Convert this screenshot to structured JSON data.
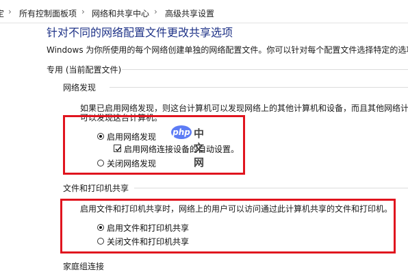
{
  "breadcrumb": {
    "items": [
      "所有控制面板项",
      "网络和共享中心",
      "高级共享设置"
    ],
    "partial_first": "定"
  },
  "main": {
    "heading": "针对不同的网络配置文件更改共享选项",
    "description": "Windows 为你所使用的每个网络创建单独的网络配置文件。你可以针对每个配置文件选择特定的选项。",
    "profile_label": "专用 (当前配置文件)",
    "network_discovery": {
      "label": "网络发现",
      "description_line1": "如果已启用网络发现，则这台计算机可以发现网络上的其他计算机和设备，而且其他网络计算",
      "description_line2": "可以发现这台计算机。",
      "options": [
        {
          "label": "启用网络发现",
          "checked": true
        },
        {
          "label": "关闭网络发现",
          "checked": false
        }
      ],
      "auto_setup": {
        "label": "启用网络连接设备的自动设置。",
        "checked": true
      }
    },
    "file_printer_sharing": {
      "label": "文件和打印机共享",
      "description": "启用文件和打印机共享时，网络上的用户可以访问通过此计算机共享的文件和打印机。",
      "options": [
        {
          "label": "启用文件和打印机共享",
          "checked": true
        },
        {
          "label": "关闭文件和打印机共享",
          "checked": false
        }
      ]
    },
    "homegroup_label": "家庭组连接"
  },
  "watermark": {
    "logo_text": "php",
    "site_text": "中文网"
  },
  "colors": {
    "heading": "#1e3287",
    "highlight": "#e0141e"
  }
}
